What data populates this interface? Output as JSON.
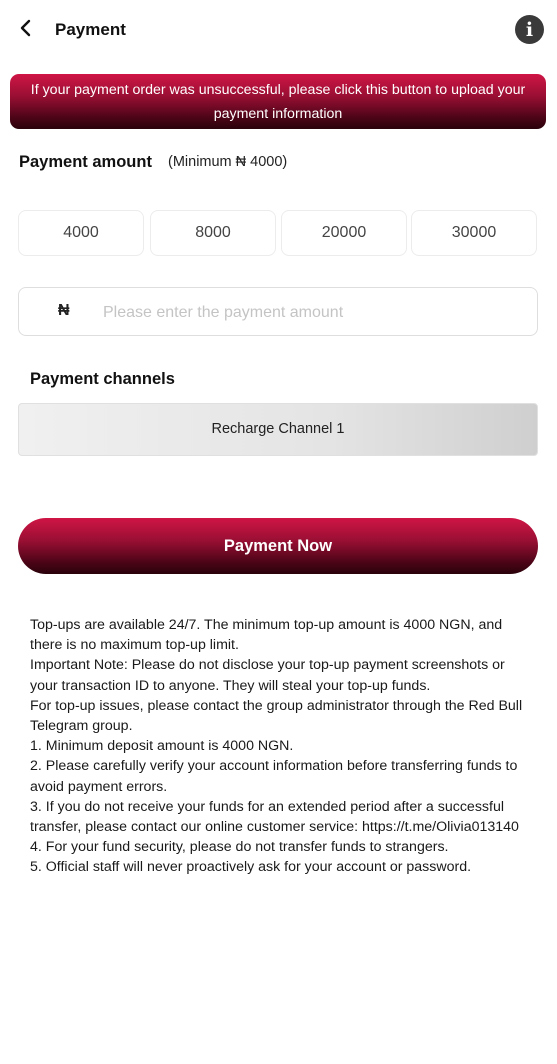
{
  "header": {
    "title": "Payment",
    "back_icon": "chevron-left-icon",
    "info_icon": "info-icon",
    "info_glyph": "i"
  },
  "banner": {
    "text": "If your payment order was unsuccessful, please click this button to upload your payment information"
  },
  "payment_amount": {
    "heading": "Payment amount",
    "minimum_note": "(Minimum ₦ 4000)",
    "options": [
      "4000",
      "8000",
      "20000",
      "30000"
    ],
    "currency_symbol": "₦",
    "input_value": "",
    "input_placeholder": "Please enter the payment amount"
  },
  "channels": {
    "heading": "Payment channels",
    "items": [
      {
        "label": "Recharge Channel 1"
      }
    ]
  },
  "submit": {
    "label": "Payment Now"
  },
  "notes": {
    "lines": [
      "Top-ups are available 24/7. The minimum top-up amount is 4000 NGN, and there is no maximum top-up limit.",
      "Important Note: Please do not disclose your top-up payment screenshots or your transaction ID to anyone. They will steal your top-up funds.",
      "For top-up issues, please contact the group administrator through the Red Bull Telegram group.",
      "1. Minimum deposit amount is 4000 NGN.",
      "2. Please carefully verify your account information before transferring funds to avoid payment errors.",
      "3. If you do not receive your funds for an extended period after a successful transfer, please contact our online customer service: https://t.me/Olivia013140",
      "4. For your fund security, please do not transfer funds to strangers.",
      "5. Official staff will never proactively ask for your account or password."
    ]
  },
  "colors": {
    "accent_top": "#cf1545",
    "accent_bottom": "#2a020b",
    "info_button": "#3a3a3a"
  }
}
